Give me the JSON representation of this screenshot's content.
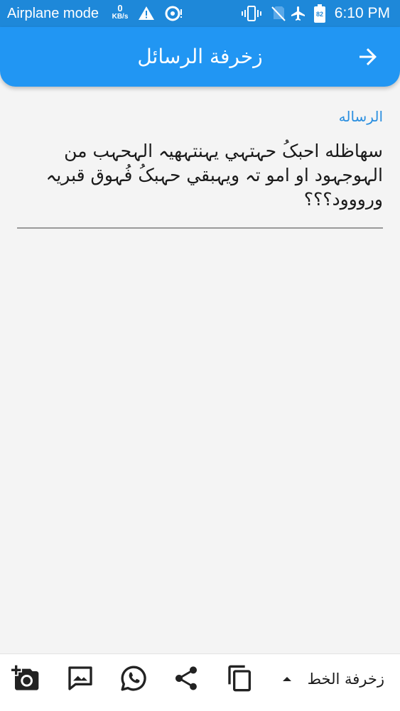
{
  "status_bar": {
    "mode_label": "Airplane mode",
    "net_speed_value": "0",
    "net_speed_unit": "KB/s",
    "battery_level": "82",
    "time": "6:10 PM",
    "icons": [
      "warning-icon",
      "data-saver-icon",
      "vibrate-icon",
      "no-sim-icon",
      "airplane-icon",
      "battery-icon"
    ]
  },
  "app_bar": {
    "title": "زخرفة الرسائل",
    "nav_icon": "arrow-forward-icon",
    "color": "#2196f3"
  },
  "message_field": {
    "label": "الرساله",
    "value": "سهاظله احبکُ حہتہي يہنتہهيہ الہحہب من الہوجہود او امو تہ ويہبقي حہبکُ فُہوق قبريہ ورووود؟؟؟"
  },
  "toolbar": {
    "font_style_label": "زخرفة الخط",
    "buttons": [
      "add-photo-icon",
      "image-message-icon",
      "whatsapp-icon",
      "share-icon",
      "copy-icon",
      "dropdown-arrow-icon"
    ]
  },
  "colors": {
    "status_bar": "#1e88d9",
    "accent": "#2196f3",
    "label": "#2a8fe0"
  }
}
